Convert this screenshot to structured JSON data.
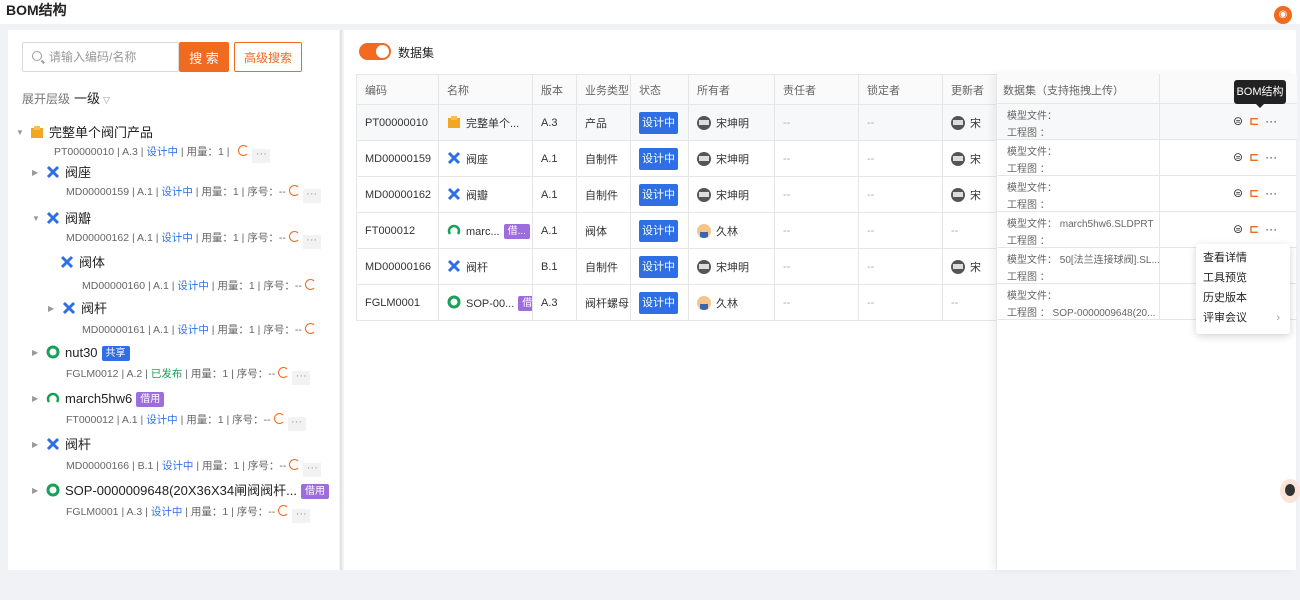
{
  "page_title": "BOM结构",
  "search": {
    "placeholder": "请输入编码/名称",
    "search_btn": "搜 索",
    "adv_btn": "高级搜索"
  },
  "expand": {
    "label": "展开层级",
    "value": "一级"
  },
  "tree": [
    {
      "title": "完整单个阀门产品",
      "meta_a": "PT00000010 | A.3 |",
      "status": "设计中",
      "meta_b": "| 用量：1 |",
      "icon": "product-icon",
      "tag": ""
    },
    {
      "title": "阀座",
      "meta_a": "MD00000159 | A.1 |",
      "status": "设计中",
      "meta_b": "| 用量：1 | 序号：--",
      "icon": "part-icon",
      "tag": ""
    },
    {
      "title": "阀瓣",
      "meta_a": "MD00000162 | A.1 |",
      "status": "设计中",
      "meta_b": "| 用量：1 | 序号：--",
      "icon": "part-icon",
      "tag": ""
    },
    {
      "title": "阀体",
      "meta_a": "MD00000160 | A.1 |",
      "status": "设计中",
      "meta_b": "| 用量：1 | 序号：--",
      "icon": "part-icon",
      "tag": ""
    },
    {
      "title": "阀杆",
      "meta_a": "MD00000161 | A.1 |",
      "status": "设计中",
      "meta_b": "| 用量：1 | 序号：--",
      "icon": "part-icon",
      "tag": ""
    },
    {
      "title": "nut30",
      "meta_a": "FGLM0012 | A.2 |",
      "status": "已发布",
      "meta_b": "| 用量：1 | 序号：--",
      "icon": "gear-icon",
      "tag": "共享"
    },
    {
      "title": "march5hw6",
      "meta_a": "FT000012 | A.1 |",
      "status": "设计中",
      "meta_b": "| 用量：1 | 序号：--",
      "icon": "shape-icon",
      "tag": "借用"
    },
    {
      "title": "阀杆",
      "meta_a": "MD00000166 | B.1 |",
      "status": "设计中",
      "meta_b": "| 用量：1 | 序号：--",
      "icon": "part-icon",
      "tag": ""
    },
    {
      "title": "SOP-0000009648(20X36X34闸阀阀杆...",
      "meta_a": "FGLM0001 | A.3 |",
      "status": "设计中",
      "meta_b": "| 用量：1 | 序号：--",
      "icon": "gear-icon",
      "tag": "借用"
    }
  ],
  "dataset_label": "数据集",
  "table": {
    "headers": [
      "编码",
      "名称",
      "版本",
      "业务类型",
      "状态",
      "所有者",
      "责任者",
      "锁定者",
      "更新者"
    ],
    "rows": [
      {
        "code": "PT00000010",
        "name": "完整单个...",
        "tag": "",
        "ver": "A.3",
        "type": "产品",
        "status": "设计中",
        "owner": "宋坤明",
        "resp": "--",
        "lock": "--",
        "upd": "宋"
      },
      {
        "code": "MD00000159",
        "name": "阀座",
        "tag": "",
        "ver": "A.1",
        "type": "自制件",
        "status": "设计中",
        "owner": "宋坤明",
        "resp": "--",
        "lock": "--",
        "upd": "宋"
      },
      {
        "code": "MD00000162",
        "name": "阀瓣",
        "tag": "",
        "ver": "A.1",
        "type": "自制件",
        "status": "设计中",
        "owner": "宋坤明",
        "resp": "--",
        "lock": "--",
        "upd": "宋"
      },
      {
        "code": "FT000012",
        "name": "marc...",
        "tag": "借...",
        "ver": "A.1",
        "type": "阀体",
        "status": "设计中",
        "owner": "久林",
        "resp": "--",
        "lock": "--",
        "upd": "--"
      },
      {
        "code": "MD00000166",
        "name": "阀杆",
        "tag": "",
        "ver": "B.1",
        "type": "自制件",
        "status": "设计中",
        "owner": "宋坤明",
        "resp": "--",
        "lock": "--",
        "upd": "宋"
      },
      {
        "code": "FGLM0001",
        "name": "SOP-00...",
        "tag": "借",
        "ver": "A.3",
        "type": "阀杆螺母",
        "status": "设计中",
        "owner": "久林",
        "resp": "--",
        "lock": "--",
        "upd": "--"
      }
    ]
  },
  "dataset_panel": {
    "header": "数据集（支持拖拽上传）",
    "rows": [
      {
        "model": "模型文件：",
        "drawing": "工程图 ："
      },
      {
        "model": "模型文件：",
        "drawing": "工程图 ："
      },
      {
        "model": "模型文件：",
        "drawing": "工程图 ："
      },
      {
        "model": "模型文件： march5hw6.SLDPRT",
        "drawing": "工程图 ："
      },
      {
        "model": "模型文件： 50[法兰连接球阀].SL...",
        "drawing": "工程图 ："
      },
      {
        "model": "模型文件：",
        "drawing": "工程图 ： SOP-0000009648(20..."
      }
    ]
  },
  "tooltip": "BOM结构",
  "context_menu": [
    "查看详情",
    "工具预览",
    "历史版本",
    "评审会议"
  ],
  "colors": {
    "accent": "#f06a1f",
    "status_blue": "#2f6fe5",
    "published_green": "#18a058",
    "borrow_purple": "#9d6dde"
  }
}
